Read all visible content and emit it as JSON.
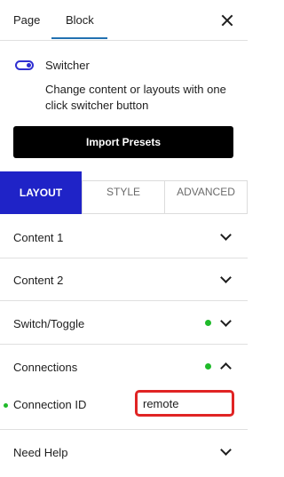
{
  "tabs": {
    "page": "Page",
    "block": "Block"
  },
  "block": {
    "name": "Switcher",
    "description": "Change content or layouts with one click switcher button"
  },
  "import_button": "Import Presets",
  "panel_tabs": {
    "layout": "LAYOUT",
    "style": "STYLE",
    "advanced": "ADVANCED"
  },
  "accordion": [
    {
      "label": "Content 1",
      "status_dot": false,
      "expanded": false
    },
    {
      "label": "Content 2",
      "status_dot": false,
      "expanded": false
    },
    {
      "label": "Switch/Toggle",
      "status_dot": true,
      "expanded": false
    },
    {
      "label": "Connections",
      "status_dot": true,
      "expanded": true
    },
    {
      "label": "Need Help",
      "status_dot": false,
      "expanded": false
    }
  ],
  "connection_field": {
    "label": "Connection ID",
    "value": "remote"
  },
  "colors": {
    "accent": "#1f23c7",
    "status_green": "#1fba2a",
    "highlight": "#e02424"
  }
}
